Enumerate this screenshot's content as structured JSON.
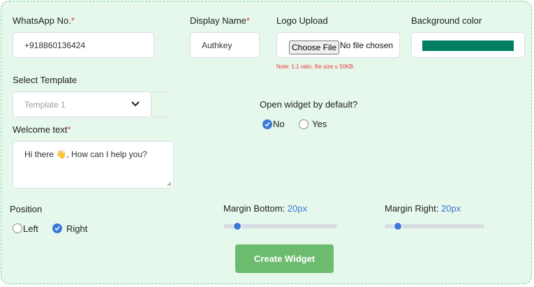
{
  "whatsapp": {
    "label": "WhatsApp No.",
    "required": "*",
    "value": "+918860136424"
  },
  "display_name": {
    "label": "Display Name",
    "required": "*",
    "value": "Authkey"
  },
  "logo_upload": {
    "label": "Logo Upload",
    "button": "Choose File",
    "status": "No file chosen",
    "note": "Note: 1:1 ratio, file size ≤ 50KB."
  },
  "background_color": {
    "label": "Background color",
    "value": "#008061"
  },
  "template": {
    "label": "Select Template",
    "selected": "Template 1"
  },
  "welcome": {
    "label": "Welcome text",
    "required": "*",
    "value": "Hi there 👋, How can I help you?"
  },
  "open_widget": {
    "label": "Open widget by default?",
    "options": [
      {
        "label": "No",
        "checked": true
      },
      {
        "label": "Yes",
        "checked": false
      }
    ]
  },
  "position": {
    "label": "Position",
    "options": [
      {
        "label": "Left",
        "checked": false
      },
      {
        "label": "Right",
        "checked": true
      }
    ]
  },
  "margin_bottom": {
    "label": "Margin Bottom:",
    "value": "20px"
  },
  "margin_right": {
    "label": "Margin Right:",
    "value": "20px"
  },
  "submit": {
    "label": "Create Widget"
  },
  "colors": {
    "accent": "#3b78d8",
    "panel": "#e6f7ec",
    "button": "#6cbb6f",
    "required": "#e53935"
  }
}
